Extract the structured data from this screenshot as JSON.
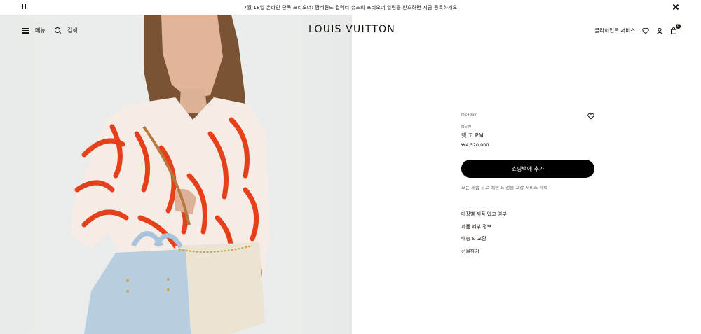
{
  "announcement": {
    "text": "7월 18일 온라인 단독 프리오더: 팜버젼드 컬렉터 슈즈의 프리오더 알림을 받으려면 지금 등록하세요"
  },
  "header": {
    "menu_label": "메뉴",
    "search_label": "검색",
    "logo": "LOUIS VUITTON",
    "client_service": "클라이언트 서비스",
    "cart_count": "0"
  },
  "product": {
    "sku": "M24897",
    "badge": "NEW",
    "name": "렛 고 PM",
    "price": "₩4,520,000",
    "cart_button": "쇼핑백에 추가",
    "service_note": "모든 제품 무료 배송 & 선물 포장 서비스 혜택",
    "links": [
      "매장별 제품 입고 여부",
      "제품 세부 정보",
      "배송 & 교환",
      "선물하기"
    ]
  },
  "colors": {
    "text": "#19110b",
    "button_bg": "#000000",
    "image_bg": "#eaeceb",
    "shirt_print": "#e6401b"
  },
  "icons": [
    "pause-icon",
    "close-icon",
    "menu-icon",
    "search-icon",
    "heart-icon",
    "account-icon",
    "bag-icon"
  ]
}
